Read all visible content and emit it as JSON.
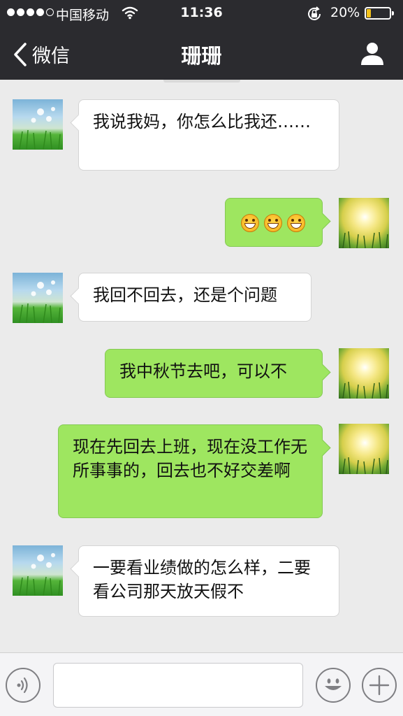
{
  "status_bar": {
    "carrier": "中国移动",
    "time": "11:36",
    "battery_percent": "20%",
    "battery_level": 0.2,
    "signal_dots": [
      true,
      true,
      true,
      true,
      false
    ],
    "icons": [
      "signal-dots-icon",
      "wifi-icon",
      "rotation-lock-icon",
      "battery-icon"
    ],
    "battery_color": "#f4c21b"
  },
  "nav": {
    "back_label": "微信",
    "title": "珊珊",
    "icons": [
      "chevron-left-icon",
      "person-icon"
    ]
  },
  "messages": [
    {
      "side": "them",
      "text": "我说我妈，你怎么比我还……"
    },
    {
      "side": "me",
      "text": "",
      "emoji_count": 3
    },
    {
      "side": "them",
      "text": "我回不回去，还是个问题"
    },
    {
      "side": "me",
      "text": "我中秋节去吧，可以不"
    },
    {
      "side": "me",
      "text": "现在先回去上班，现在没工作无所事事的，回去也不好交差啊"
    },
    {
      "side": "them",
      "text": "一要看业绩做的怎么样，二要看公司那天放天假不"
    }
  ],
  "input_bar": {
    "icons": [
      "voice-icon",
      "smiley-icon",
      "plus-icon"
    ]
  },
  "colors": {
    "header_bg": "#2b2b2f",
    "chat_bg": "#ebebeb",
    "my_bubble": "#9ee660",
    "their_bubble": "#ffffff"
  }
}
